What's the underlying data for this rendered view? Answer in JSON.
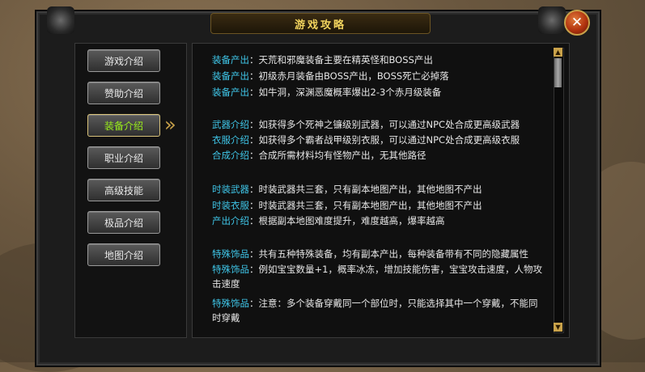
{
  "dialog": {
    "title": "游戏攻略",
    "close_glyph": "✕"
  },
  "nav": {
    "items": [
      {
        "label": "游戏介绍",
        "active": false
      },
      {
        "label": "赞助介绍",
        "active": false
      },
      {
        "label": "装备介绍",
        "active": true
      },
      {
        "label": "职业介绍",
        "active": false
      },
      {
        "label": "高级技能",
        "active": false
      },
      {
        "label": "极品介绍",
        "active": false
      },
      {
        "label": "地图介绍",
        "active": false
      }
    ],
    "active_arrow": "»"
  },
  "content": {
    "lines": [
      {
        "label": "装备产出",
        "text": "：天荒和邪魔装备主要在精英怪和BOSS产出"
      },
      {
        "label": "装备产出",
        "text": "：初级赤月装备由BOSS产出，BOSS死亡必掉落"
      },
      {
        "label": "装备产出",
        "text": "：如牛洞，深渊恶魔概率爆出2-3个赤月级装备"
      },
      {
        "label": "武器介绍",
        "text": "：如获得多个死神之镰级别武器，可以通过NPC处合成更高级武器"
      },
      {
        "label": "衣服介绍",
        "text": "：如获得多个霸者战甲级别衣服，可以通过NPC处合成更高级衣服"
      },
      {
        "label": "合成介绍",
        "text": "：合成所需材料均有怪物产出，无其他路径"
      },
      {
        "label": "时装武器",
        "text": "：时装武器共三套，只有副本地图产出，其他地图不产出"
      },
      {
        "label": "时装衣服",
        "text": "：时装武器共三套，只有副本地图产出，其他地图不产出"
      },
      {
        "label": "产出介绍",
        "text": "：根据副本地图难度提升，难度越高，爆率越高"
      },
      {
        "label": "特殊饰品",
        "text": "：共有五种特殊装备，均有副本产出，每种装备带有不同的隐藏属性"
      },
      {
        "label": "特殊饰品",
        "text": "：例如宝宝数量+1，概率冰冻，增加技能伤害，宝宝攻击速度，人物攻击速度"
      },
      {
        "label": "特殊饰品",
        "text": "：注意：多个装备穿戴同一个部位时，只能选择其中一个穿戴，不能同时穿戴"
      }
    ]
  },
  "scrollbar": {
    "up_glyph": "▲",
    "down_glyph": "▼"
  },
  "colors": {
    "label_cyan": "#3fc6e8",
    "active_green": "#9bf01a",
    "title_gold": "#f2d45e",
    "close_red": "#b2340f"
  }
}
